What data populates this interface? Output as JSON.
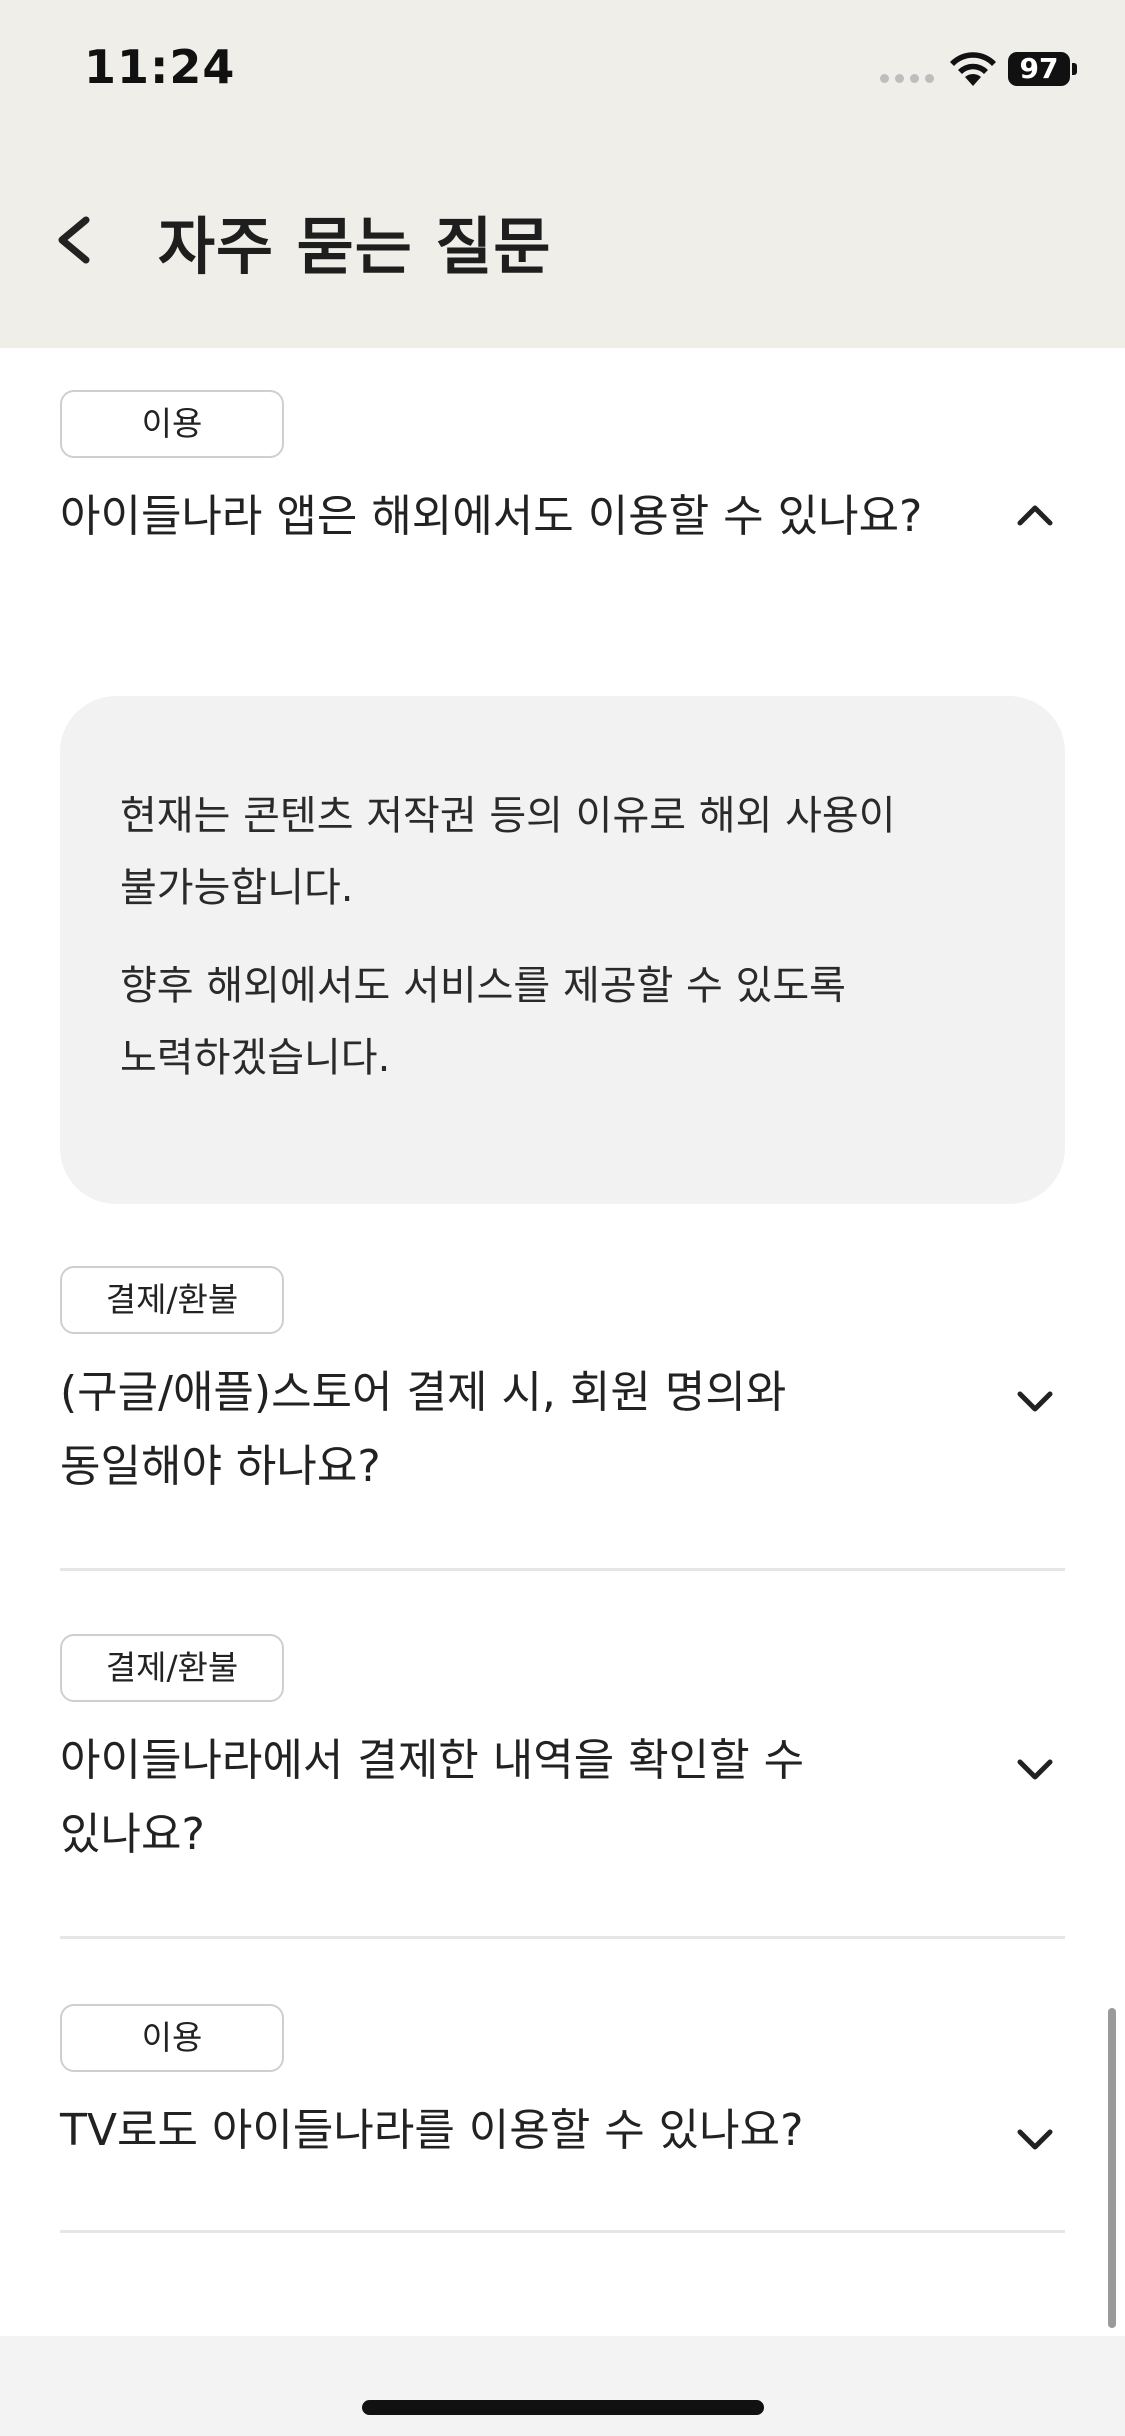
{
  "status_bar": {
    "time": "11:24",
    "battery": "97",
    "wifi_icon": "wifi-icon",
    "signal_icon": "signal-dots-icon"
  },
  "header": {
    "title": "자주 묻는 질문",
    "back_icon": "chevron-left-icon"
  },
  "faq": {
    "items": [
      {
        "category": "이용",
        "question": "아이들나라 앱은 해외에서도 이용할 수 있나요?",
        "expanded": true,
        "answer": [
          "현재는 콘텐츠 저작권 등의 이유로 해외 사용이 불가능합니다.",
          "향후 해외에서도 서비스를 제공할 수 있도록 노력하겠습니다."
        ]
      },
      {
        "category": "결제/환불",
        "question": "(구글/애플)스토어 결제 시, 회원 명의와 동일해야 하나요?",
        "expanded": false
      },
      {
        "category": "결제/환불",
        "question": "아이들나라에서 결제한 내역을 확인할 수 있나요?",
        "expanded": false
      },
      {
        "category": "이용",
        "question": "TV로도 아이들나라를 이용할 수 있나요?",
        "expanded": false
      }
    ]
  },
  "colors": {
    "header_bg": "#efeee8",
    "answer_bg": "#f2f2f2",
    "badge_border": "#cfcfcf",
    "text": "#222222"
  }
}
